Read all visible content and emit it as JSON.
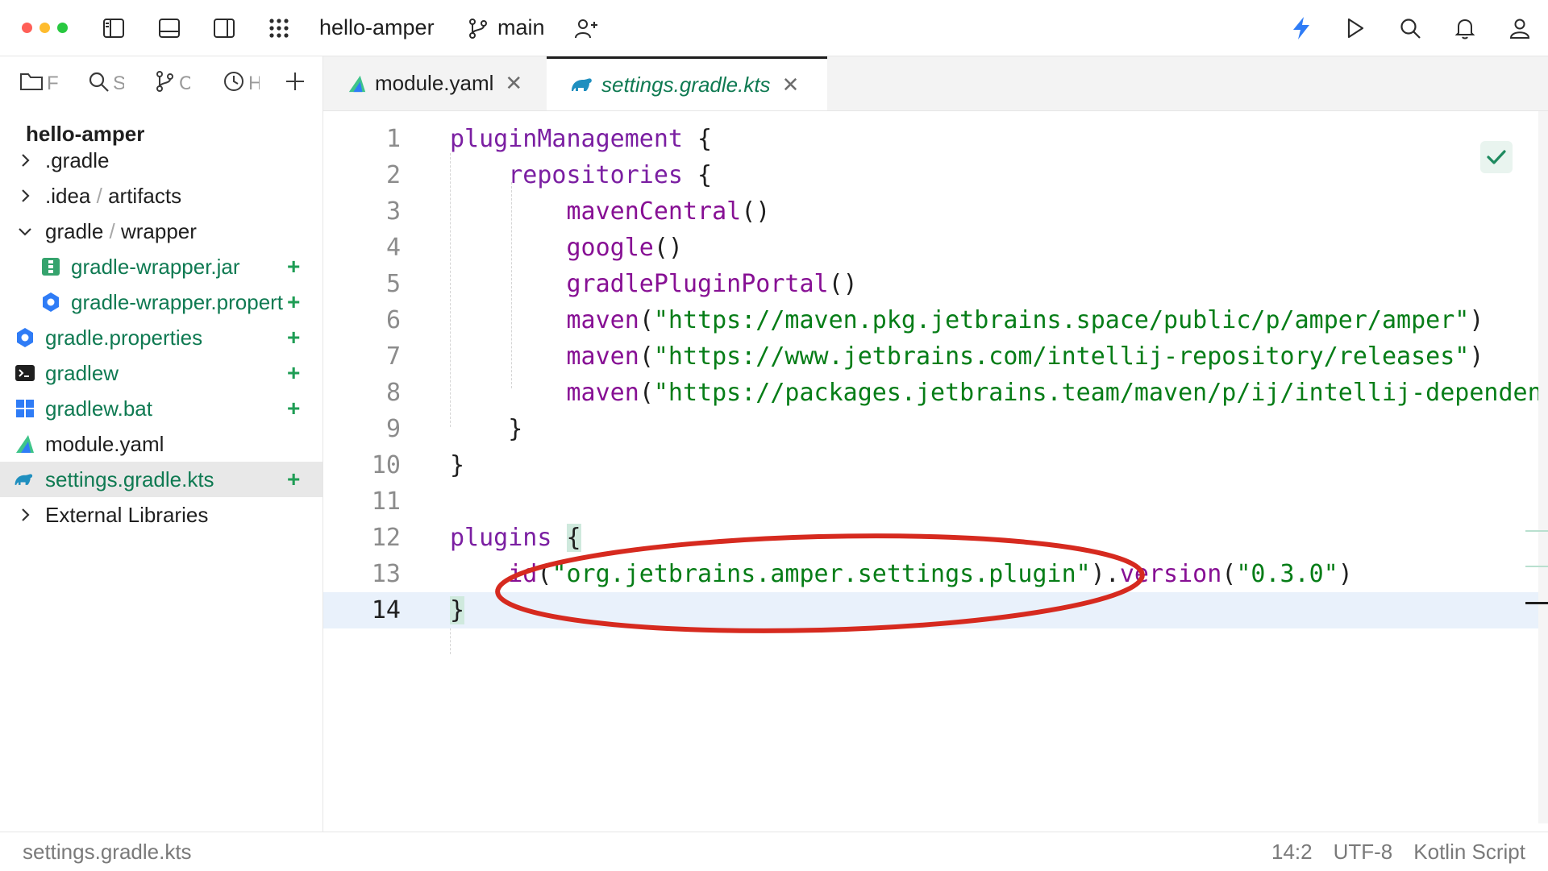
{
  "titlebar": {
    "project": "hello-amper",
    "branch": "main",
    "traffic_colors": [
      "#ff5f57",
      "#febc2e",
      "#28c840"
    ],
    "icons": [
      "left-panel-icon",
      "bottom-panel-icon",
      "right-panel-icon",
      "apps-grid-icon",
      "branch-icon",
      "add-user-icon",
      "lightning-icon",
      "run-icon",
      "search-icon",
      "bell-icon",
      "profile-icon"
    ]
  },
  "tool_tabs": [
    {
      "icon": "folder-icon",
      "label": "F"
    },
    {
      "icon": "search-icon",
      "label": "S"
    },
    {
      "icon": "branch-icon",
      "label": "C"
    },
    {
      "icon": "clock-icon",
      "label": "H"
    },
    {
      "icon": "plus-icon",
      "label": ""
    }
  ],
  "tree": {
    "title": "hello-amper",
    "items": [
      {
        "label": ".gradle",
        "type": "folder",
        "state": "collapsed",
        "color": "dark"
      },
      {
        "label": ".idea",
        "sep": "/",
        "label2": "artifacts",
        "type": "folder",
        "state": "collapsed",
        "color": "dark"
      },
      {
        "label": "gradle",
        "sep": "/",
        "label2": "wrapper",
        "type": "folder",
        "state": "expanded",
        "color": "dark"
      },
      {
        "label": "gradle-wrapper.jar",
        "type": "jar",
        "added": "+",
        "color": "green"
      },
      {
        "label": "gradle-wrapper.properties",
        "type": "properties",
        "added": "+",
        "color": "green"
      },
      {
        "label": "gradle.properties",
        "type": "properties",
        "added": "+",
        "color": "green"
      },
      {
        "label": "gradlew",
        "type": "shell",
        "added": "+",
        "color": "green"
      },
      {
        "label": "gradlew.bat",
        "type": "bat",
        "added": "+",
        "color": "green"
      },
      {
        "label": "module.yaml",
        "type": "amper",
        "added": "",
        "color": "dark"
      },
      {
        "label": "settings.gradle.kts",
        "type": "gradle",
        "added": "+",
        "color": "green",
        "selected": true
      },
      {
        "label": "External Libraries",
        "type": "folder",
        "state": "collapsed",
        "color": "dark"
      }
    ]
  },
  "editor_tabs": [
    {
      "label": "module.yaml",
      "icon": "amper-icon",
      "active": false
    },
    {
      "label": "settings.gradle.kts",
      "icon": "gradle-elephant-icon",
      "active": true
    }
  ],
  "code_lines": [
    {
      "n": "1",
      "text": "pluginManagement {"
    },
    {
      "n": "2",
      "text": "    repositories {"
    },
    {
      "n": "3",
      "text": "        mavenCentral()"
    },
    {
      "n": "4",
      "text": "        google()"
    },
    {
      "n": "5",
      "text": "        gradlePluginPortal()"
    },
    {
      "n": "6",
      "text": "        maven(\"https://maven.pkg.jetbrains.space/public/p/amper/amper\")"
    },
    {
      "n": "7",
      "text": "        maven(\"https://www.jetbrains.com/intellij-repository/releases\")"
    },
    {
      "n": "8",
      "text": "        maven(\"https://packages.jetbrains.team/maven/p/ij/intellij-dependencies\")"
    },
    {
      "n": "9",
      "text": "    }"
    },
    {
      "n": "10",
      "text": "}"
    },
    {
      "n": "11",
      "text": ""
    },
    {
      "n": "12",
      "text": "plugins {"
    },
    {
      "n": "13",
      "text": "    id(\"org.jetbrains.amper.settings.plugin\").version(\"0.3.0\")"
    },
    {
      "n": "14",
      "text": "}"
    }
  ],
  "current_line": 14,
  "annotation_color": "#d62a1f",
  "status": {
    "path": "settings.gradle.kts",
    "position": "14:2",
    "encoding": "UTF-8",
    "language": "Kotlin Script"
  }
}
